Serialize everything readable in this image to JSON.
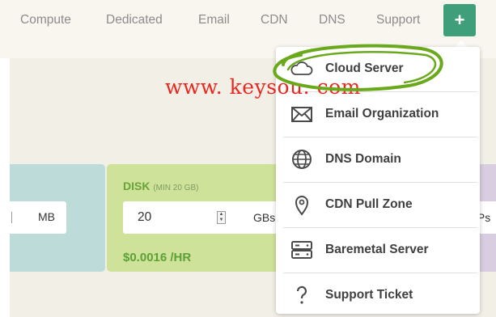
{
  "nav": {
    "compute": "Compute",
    "dedicated": "Dedicated",
    "email": "Email",
    "cdn": "CDN",
    "dns": "DNS",
    "support": "Support",
    "add_button_symbol": "+"
  },
  "calculator": {
    "memory_unit": "MB",
    "disk": {
      "title": "DISK",
      "note": "(MIN 20 GB)",
      "value": "20",
      "unit": "GBs",
      "price": "$0.0016 /HR"
    },
    "ips_unit": "IPs"
  },
  "create_menu": {
    "items": [
      {
        "label": "Cloud Server",
        "icon": "cloud-icon"
      },
      {
        "label": "Email Organization",
        "icon": "envelope-icon"
      },
      {
        "label": "DNS Domain",
        "icon": "globe-icon"
      },
      {
        "label": "CDN Pull Zone",
        "icon": "map-pin-icon"
      },
      {
        "label": "Baremetal Server",
        "icon": "server-icon"
      },
      {
        "label": "Support Ticket",
        "icon": "question-mark-icon"
      }
    ]
  },
  "watermark": "www. keysou. com",
  "colors": {
    "accent": "#3f9f7a",
    "disk_card": "#cfe29a",
    "memory_card": "#bcdbd9",
    "ips_card": "#d8cde1",
    "highlight_oval": "#6aa81c",
    "watermark": "#e8281f"
  }
}
